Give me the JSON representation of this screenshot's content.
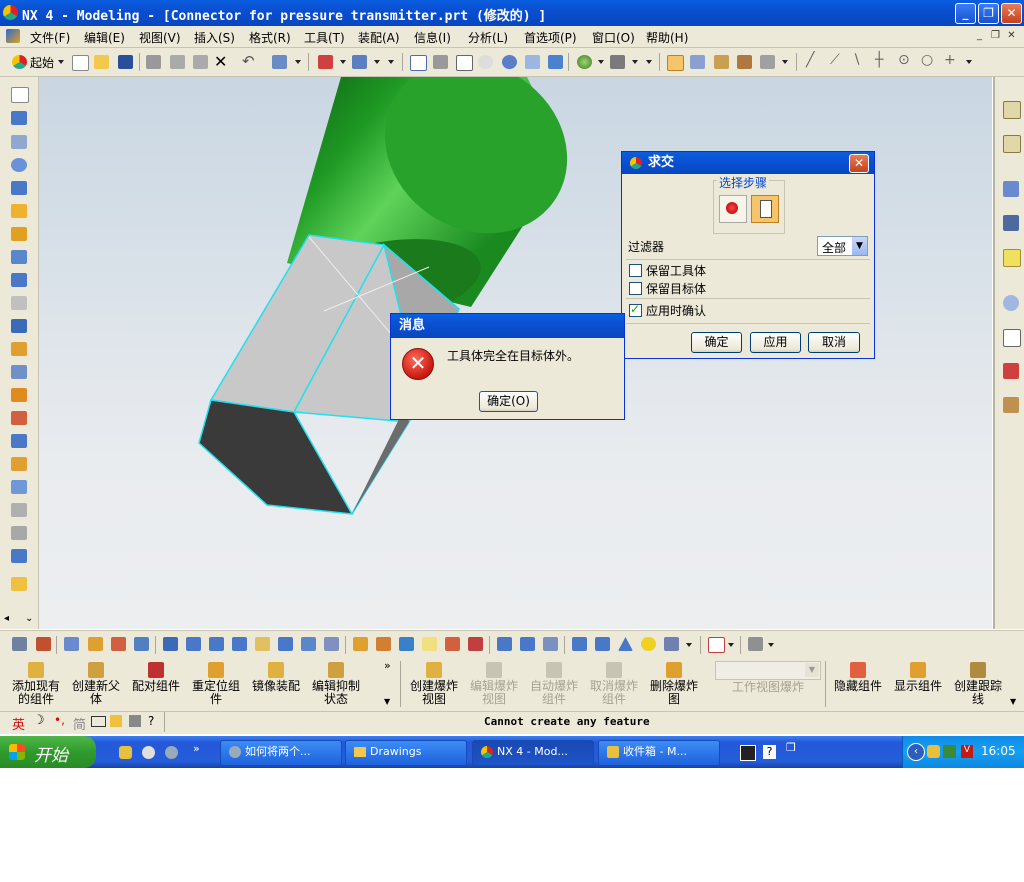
{
  "window": {
    "title": "NX 4 - Modeling - [Connector for pressure transmitter.prt  (修改的) ]"
  },
  "menu": [
    "文件(F)",
    "编辑(E)",
    "视图(V)",
    "插入(S)",
    "格式(R)",
    "工具(T)",
    "装配(A)",
    "信息(I)",
    "分析(L)",
    "首选项(P)",
    "窗口(O)",
    "帮助(H)"
  ],
  "toolbar": {
    "start_label": "起始"
  },
  "intersect_dialog": {
    "title": "求交",
    "steps_group": "选择步骤",
    "filter_label": "过滤器",
    "filter_value": "全部",
    "keep_tool": "保留工具体",
    "keep_target": "保留目标体",
    "confirm_apply": "应用时确认",
    "ok": "确定",
    "apply": "应用",
    "cancel": "取消"
  },
  "message_dialog": {
    "title": "消息",
    "text": "工具体完全在目标体外。",
    "ok": "确定(O)"
  },
  "assembly_buttons": [
    {
      "label": "添加现有\n的组件",
      "enabled": true
    },
    {
      "label": "创建新父\n体",
      "enabled": true
    },
    {
      "label": "配对组件",
      "enabled": true
    },
    {
      "label": "重定位组\n件",
      "enabled": true
    },
    {
      "label": "镜像装配",
      "enabled": true
    },
    {
      "label": "编辑抑制\n状态",
      "enabled": true
    },
    {
      "label": "创建爆炸\n视图",
      "enabled": true
    },
    {
      "label": "编辑爆炸\n视图",
      "enabled": false
    },
    {
      "label": "自动爆炸\n组件",
      "enabled": false
    },
    {
      "label": "取消爆炸\n组件",
      "enabled": false
    },
    {
      "label": "删除爆炸\n图",
      "enabled": true
    },
    {
      "label": "工作视图爆炸",
      "enabled": false
    },
    {
      "label": "隐藏组件",
      "enabled": true
    },
    {
      "label": "显示组件",
      "enabled": true
    },
    {
      "label": "创建跟踪\n线",
      "enabled": true
    }
  ],
  "status": {
    "message": "Cannot create any feature",
    "ime": [
      "英",
      "简"
    ]
  },
  "taskbar": {
    "start": "开始",
    "tasks": [
      "如何将两个...",
      "Drawings",
      "NX 4 - Mod...",
      "收件箱 - M..."
    ],
    "clock": "16:05"
  }
}
